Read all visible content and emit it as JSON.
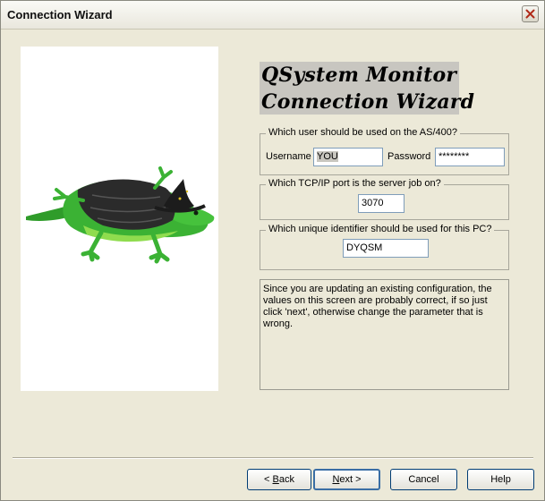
{
  "window": {
    "title": "Connection Wizard"
  },
  "heading": {
    "line1": "QSystem Monitor",
    "line2": "Connection Wizard"
  },
  "user_group": {
    "legend": "Which user should be used on the AS/400?",
    "username_label": "Username",
    "username_value": "YOU",
    "password_label": "Password",
    "password_value": "********"
  },
  "port_group": {
    "legend": "Which TCP/IP port is the server job on?",
    "port_value": "3070"
  },
  "id_group": {
    "legend": "Which unique identifier should be used for this PC?",
    "id_value": "DYQSM"
  },
  "message": "Since you are updating an existing configuration, the values on this screen are probably correct, if so just click 'next', otherwise change the parameter that is wrong.",
  "buttons": {
    "back_prefix": "< ",
    "back_key": "B",
    "back_rest": "ack",
    "next_key": "N",
    "next_rest": "ext >",
    "cancel": "Cancel",
    "help": "Help"
  },
  "icons": {
    "close": "close-icon",
    "mascot": "lizard-wizard-image"
  },
  "colors": {
    "lizard": "#3bb234",
    "cape": "#2b2b2b",
    "background": "#ece9d8"
  }
}
